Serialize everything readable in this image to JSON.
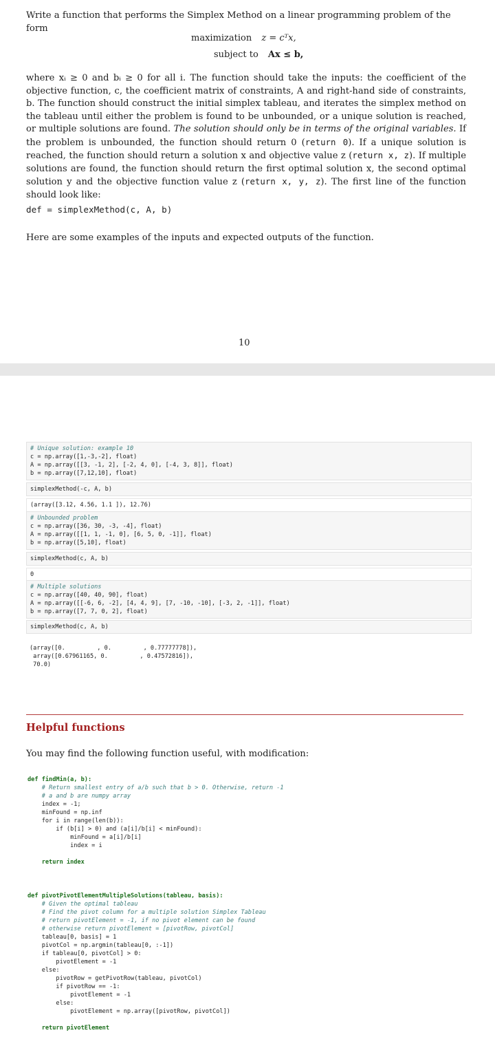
{
  "intro": "Write a function that performs the Simplex Method on a linear programming problem of the form",
  "math": {
    "max_label": "maximization",
    "max_expr": "z = cᵀx,",
    "subj_label": "subject to",
    "subj_expr": "Ax ≤ b,"
  },
  "paragraph": [
    "where x",
    "ᵢ ≥ 0 and b",
    "ᵢ ≥ 0 for all i. The function should take the inputs: the coefficient of the objective function, c, the coefficient matrix of constraints, A and right-hand side of constraints, b. The function should construct the initial simplex tableau, and iterates the simplex method on the tableau until either the problem is found to be unbounded, or a unique solution is reached, or multiple solutions are found. ",
    "The solution should only be in terms of the original variables.",
    " If the problem is unbounded, the function should return 0 (",
    "return 0",
    "). If a unique solution is reached, the function should return a solution x and objective value z (",
    "return x, z",
    "). If multiple solutions are found, the function should return the first optimal solution x, the second optimal solution y and the objective function value z (",
    "return x, y, z",
    "). The first line of the function should look like:"
  ],
  "def_line": "def = simplexMethod(c, A, b)",
  "examples_line": "Here are some examples of the inputs and expected outputs of the function.",
  "page_number": "10",
  "cells": {
    "ex1_comment": "# Unique solution: example 10",
    "ex1_c": "c = np.array([1,-3,-2], float)",
    "ex1_A": "A = np.array([[3, -1, 2], [-2, 4, 0], [-4, 3, 8]], float)",
    "ex1_b": "b = np.array([7,12,10], float)",
    "ex1_call": "simplexMethod(-c, A, b)",
    "ex1_out": "(array([3.12, 4.56, 1.1 ]), 12.76)",
    "ex2_comment": "# Unbounded problem",
    "ex2_c": "c = np.array([36, 30, -3, -4], float)",
    "ex2_A": "A = np.array([[1, 1, -1, 0], [6, 5, 0, -1]], float)",
    "ex2_b": "b = np.array([5,10], float)",
    "ex2_call": "simplexMethod(c, A, b)",
    "ex2_out": "0",
    "ex3_comment": "# Multiple solutions",
    "ex3_c": "c = np.array([40, 40, 90], float)",
    "ex3_A": "A = np.array([[-6, 6, -2], [4, 4, 9], [7, -10, -10], [-3, 2, -1]], float)",
    "ex3_b": "b = np.array([7, 7, 0, 2], float)",
    "ex3_call": "simplexMethod(c, A, b)",
    "ex3_out1": "(array([0.         , 0.         , 0.77777778]),",
    "ex3_out2": " array([0.67961165, 0.         , 0.47572816]),",
    "ex3_out3": " 70.0)"
  },
  "helpful": {
    "title": "Helpful functions",
    "text": "You may find the following function useful, with modification:"
  },
  "findmin": [
    "def findMin(a, b):",
    "    # Return smallest entry of a/b such that b > 0. Otherwise, return -1",
    "    # a and b are numpy array",
    "    index = -1;",
    "    minFound = np.inf",
    "    for i in range(len(b)):",
    "        if (b[i] > 0) and (a[i]/b[i] < minFound):",
    "            minFound = a[i]/b[i]",
    "            index = i",
    "",
    "    return index"
  ],
  "pivot": [
    "def pivotPivotElementMultipleSolutions(tableau, basis):",
    "    # Given the optimal tableau",
    "    # Find the pivot column for a multiple solution Simplex Tableau",
    "    # return pivotElement = -1, if no pivot element can be found",
    "    # otherwise return pivotElement = [pivotRow, pivotCol]",
    "    tableau[0, basis] = 1",
    "    pivotCol = np.argmin(tableau[0, :-1])",
    "    if tableau[0, pivotCol] > 0:",
    "        pivotElement = -1",
    "    else:",
    "        pivotRow = getPivotRow(tableau, pivotCol)",
    "        if pivotRow == -1:",
    "            pivotElement = -1",
    "        else:",
    "            pivotElement = np.array([pivotRow, pivotCol])",
    "",
    "    return pivotElement"
  ]
}
